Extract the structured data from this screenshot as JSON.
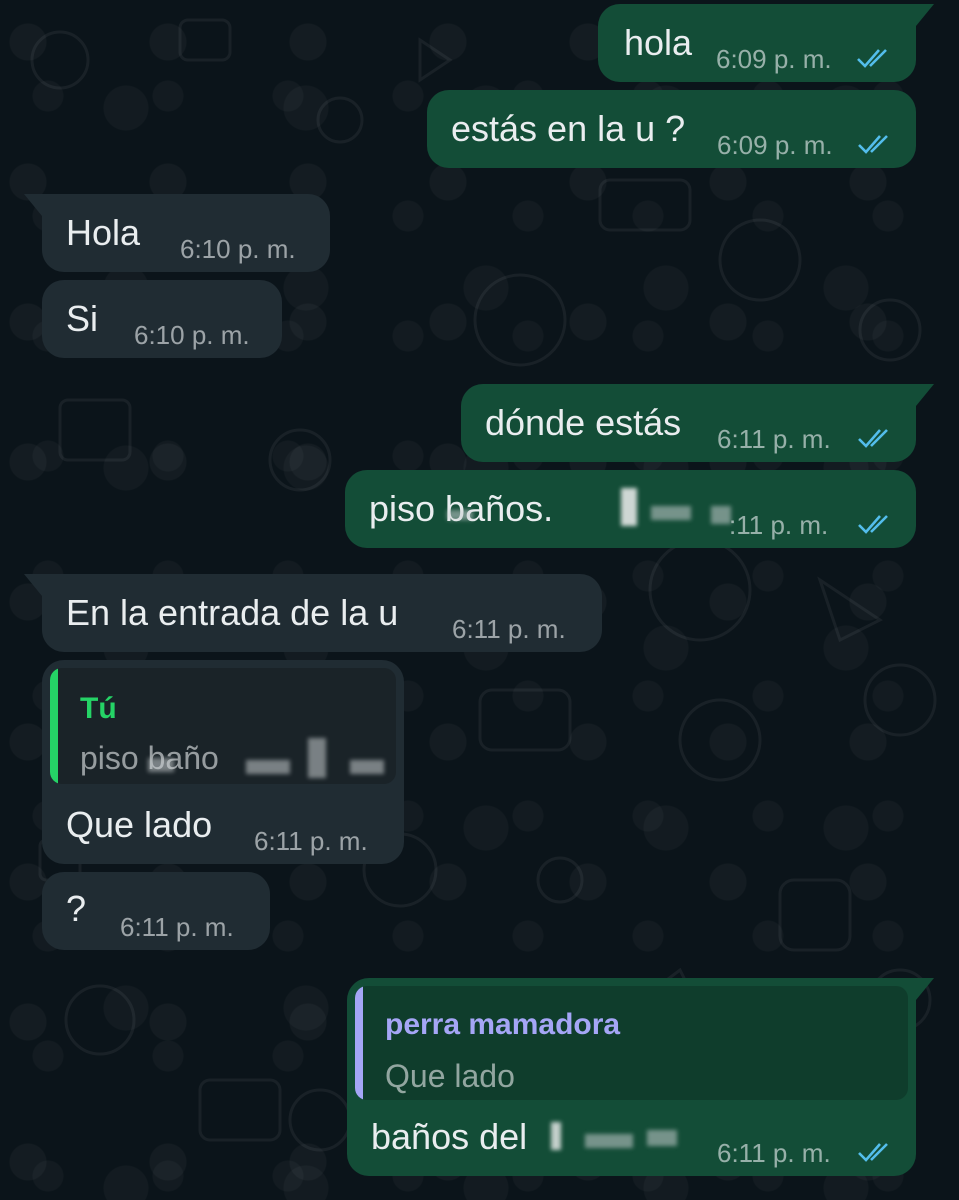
{
  "colors": {
    "background": "#0b141a",
    "incoming_bubble": "#202c33",
    "outgoing_bubble": "#134d37",
    "read_ticks": "#53bdeb",
    "quote_you": "#25d366",
    "quote_contact": "#a5a6f6"
  },
  "messages": [
    {
      "dir": "out",
      "text": "hola",
      "time": "6:09 p. m.",
      "status": "read"
    },
    {
      "dir": "out",
      "text": "estás en la u ?",
      "time": "6:09 p. m.",
      "status": "read"
    },
    {
      "dir": "in",
      "text": "Hola",
      "time": "6:10 p. m."
    },
    {
      "dir": "in",
      "text": "Si",
      "time": "6:10 p. m."
    },
    {
      "dir": "out",
      "text": "dónde estás",
      "time": "6:11 p. m.",
      "status": "read"
    },
    {
      "dir": "out",
      "text": "piso baños.",
      "time": ":11 p. m.",
      "status": "read"
    },
    {
      "dir": "in",
      "text": "En la entrada de la u",
      "time": "6:11 p. m."
    },
    {
      "dir": "in",
      "text": "Que lado",
      "time": "6:11 p. m.",
      "quote": {
        "author": "Tú",
        "text": "piso baño"
      }
    },
    {
      "dir": "in",
      "text": "?",
      "time": "6:11 p. m."
    },
    {
      "dir": "out",
      "text": "baños del",
      "time": "6:11 p. m.",
      "status": "read",
      "quote": {
        "author": "perra mamadora",
        "text": "Que lado"
      }
    }
  ]
}
